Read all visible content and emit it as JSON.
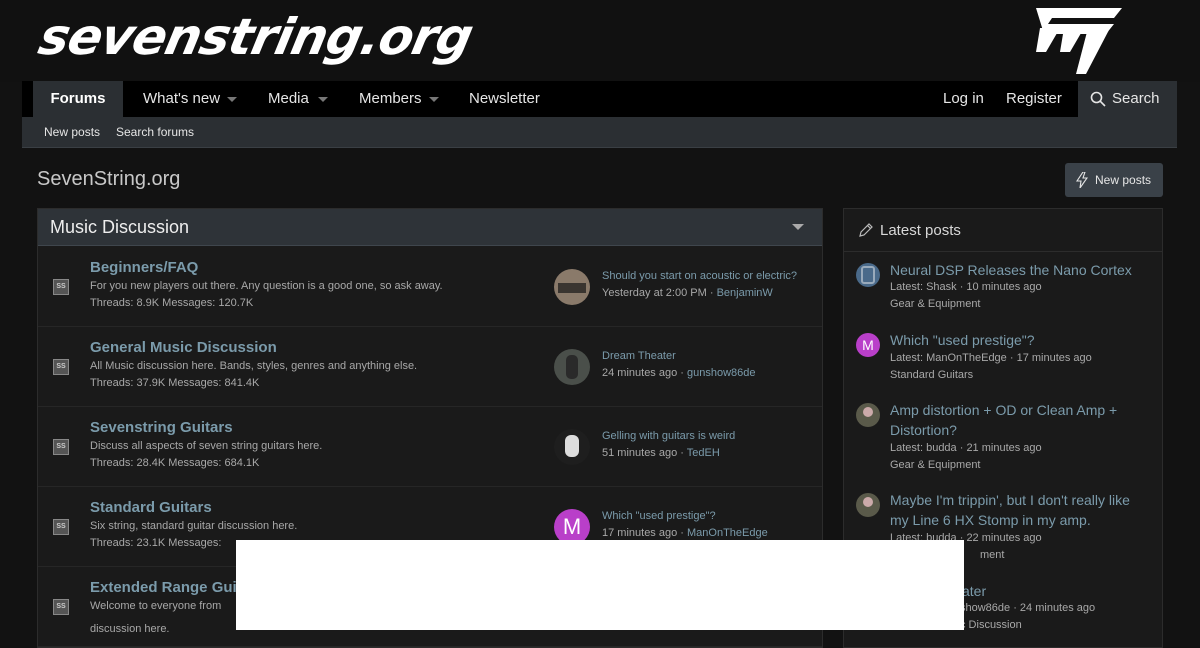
{
  "header": {
    "logo_text": "sevenstring.org",
    "logo_mark": "777"
  },
  "nav": {
    "items": [
      {
        "label": "Forums"
      },
      {
        "label": "What's new"
      },
      {
        "label": "Media"
      },
      {
        "label": "Members"
      },
      {
        "label": "Newsletter"
      }
    ],
    "login": "Log in",
    "register": "Register",
    "search": "Search"
  },
  "subnav": {
    "new_posts": "New posts",
    "search_forums": "Search forums"
  },
  "page": {
    "title": "SevenString.org",
    "new_posts_button": "New posts"
  },
  "forum_block": {
    "title": "Music Discussion",
    "forums": [
      {
        "icon": "SS",
        "name": "Beginners/FAQ",
        "description": "For you new players out there. Any question is a good one, so ask away.",
        "stats": "Threads: 8.9K Messages: 120.7K",
        "last_post_title": "Should you start on acoustic or electric?",
        "last_post_time": "Yesterday at 2:00 PM",
        "last_post_user": "BenjaminW",
        "avatar_color": "#8a7a6a"
      },
      {
        "icon": "SS",
        "name": "General Music Discussion",
        "description": "All Music discussion here. Bands, styles, genres and anything else.",
        "stats": "Threads: 37.9K Messages: 841.4K",
        "last_post_title": "Dream Theater",
        "last_post_time": "24 minutes ago",
        "last_post_user": "gunshow86de",
        "avatar_color": "#4a4f4a"
      },
      {
        "icon": "SS",
        "name": "Sevenstring Guitars",
        "description": "Discuss all aspects of seven string guitars here.",
        "stats": "Threads: 28.4K Messages: 684.1K",
        "last_post_title": "Gelling with guitars is weird",
        "last_post_time": "51 minutes ago",
        "last_post_user": "TedEH",
        "avatar_color": "#222222"
      },
      {
        "icon": "SS",
        "name": "Standard Guitars",
        "description": "Six string, standard guitar discussion here.",
        "stats": "Threads: 23.1K Messages:",
        "last_post_title": "Which \"used prestige\"?",
        "last_post_time": "17 minutes ago",
        "last_post_user": "ManOnTheEdge",
        "avatar_color": "#b93fc9",
        "avatar_letter": "M"
      },
      {
        "icon": "SS",
        "name": "Extended Range Gui",
        "description": "Welcome to everyone from",
        "stats": "discussion here.",
        "last_post_title": "",
        "last_post_time": "",
        "last_post_user": "",
        "avatar_color": "#1a1a1a"
      }
    ]
  },
  "latest": {
    "title": "Latest posts",
    "items": [
      {
        "title": "Neural DSP Releases the Nano Cortex",
        "latest": "Latest: Shask · 10 minutes ago",
        "forum": "Gear & Equipment",
        "avatar_color": "#4a6a8a"
      },
      {
        "title": "Which \"used prestige\"?",
        "latest": "Latest: ManOnTheEdge · 17 minutes ago",
        "forum": "Standard Guitars",
        "avatar_color": "#b93fc9",
        "avatar_letter": "M"
      },
      {
        "title": "Amp distortion + OD or Clean Amp + Distortion?",
        "latest": "Latest: budda · 21 minutes ago",
        "forum": "Gear & Equipment",
        "avatar_color": "#5a5a4a"
      },
      {
        "title": "Maybe I'm trippin', but I don't really like my Line 6 HX Stomp in my amp.",
        "latest": "Latest: budda · 22 minutes ago",
        "forum": "ment",
        "avatar_color": "#5a5a4a"
      },
      {
        "title": "ater",
        "latest": "show86de · 24 minutes ago",
        "forum": "c Discussion",
        "avatar_color": "#1a1a1a"
      }
    ]
  }
}
